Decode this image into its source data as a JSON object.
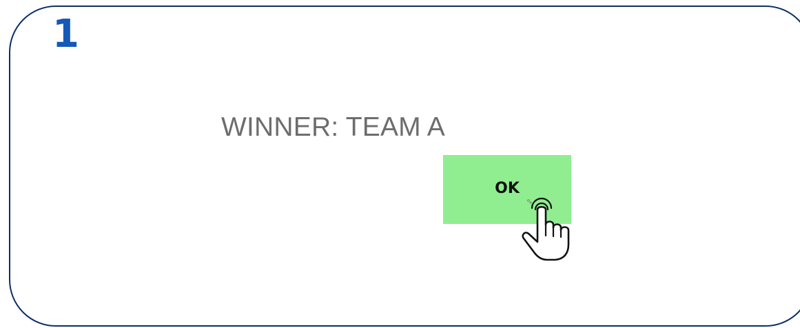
{
  "step": {
    "number": "1",
    "color": "#1458b8"
  },
  "dialog": {
    "message": "WINNER: TEAM A",
    "ok_label": "OK",
    "button_color": "#90ee90"
  },
  "frame": {
    "border_color": "#0b2f66"
  },
  "icons": {
    "cursor": "hand-pointer-icon"
  }
}
